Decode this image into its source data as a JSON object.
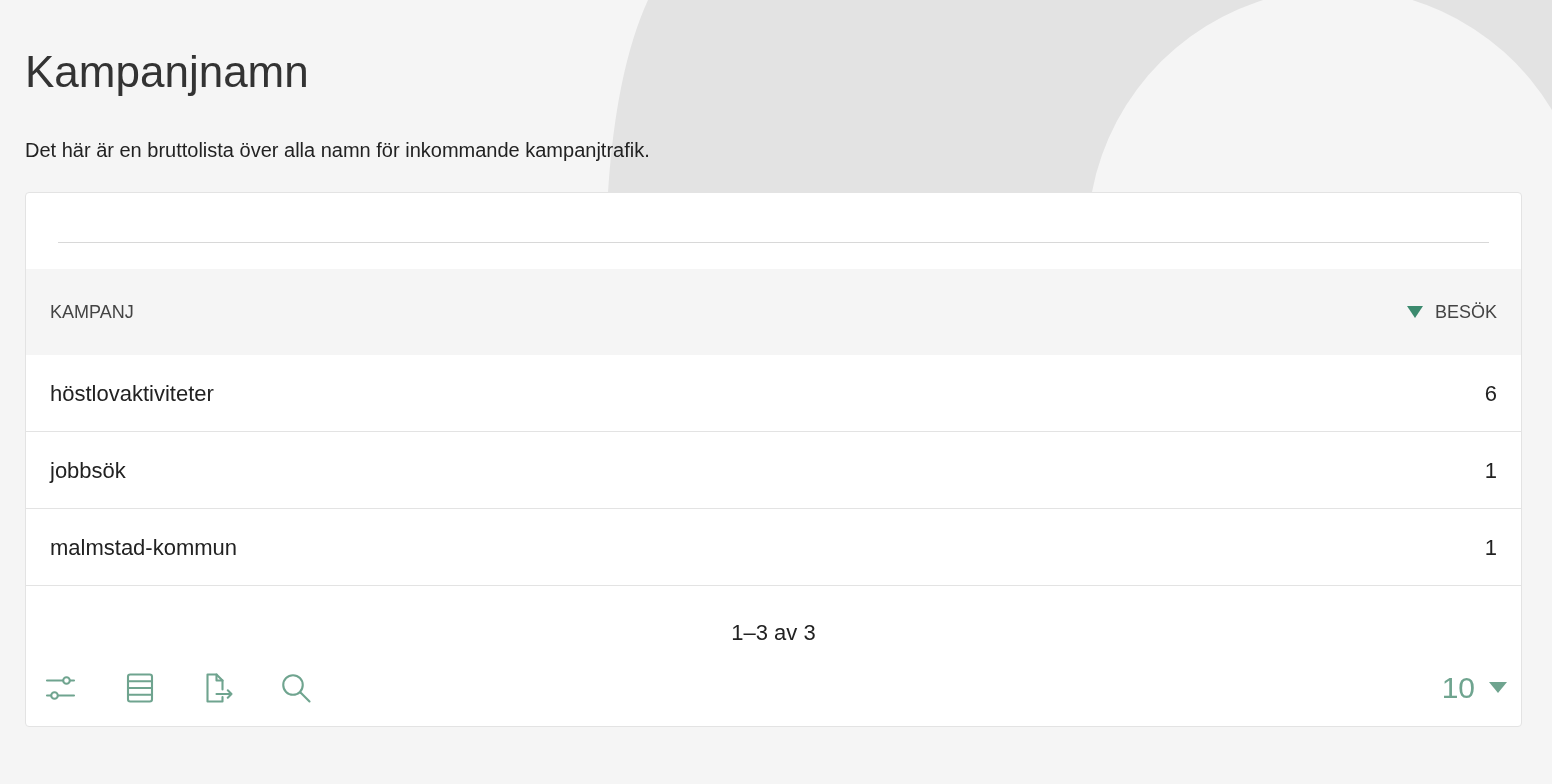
{
  "title": "Kampanjnamn",
  "description": "Det här är en bruttolista över alla namn för inkommande kampanjtrafik.",
  "table": {
    "columns": [
      {
        "label": "KAMPANJ",
        "sorted": false
      },
      {
        "label": "BESÖK",
        "sorted": true
      }
    ],
    "rows": [
      [
        "höstlovaktiviteter",
        "6"
      ],
      [
        "jobbsök",
        "1"
      ],
      [
        "malmstad-kommun",
        "1"
      ]
    ]
  },
  "pagination": "1–3 av 3",
  "toolbar": [
    {
      "kind": "filter"
    },
    {
      "kind": "table"
    },
    {
      "kind": "export"
    },
    {
      "kind": "search"
    }
  ],
  "page_size": "10"
}
